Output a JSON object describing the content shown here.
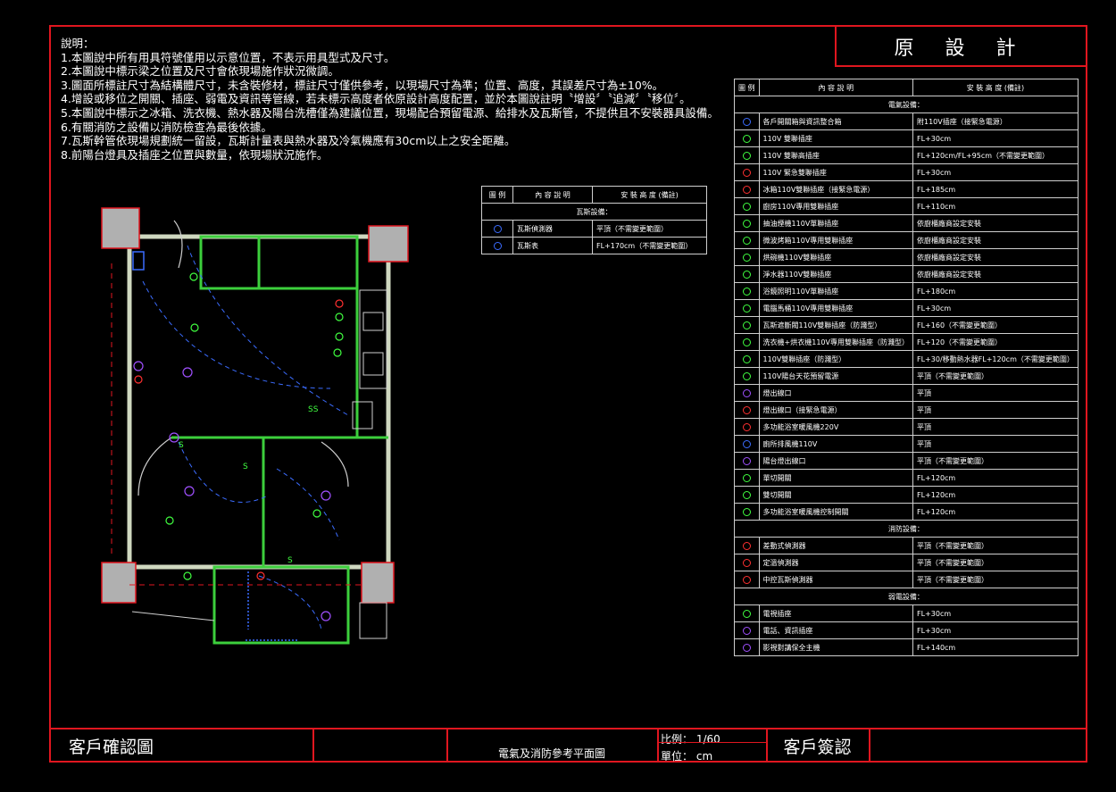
{
  "title": "原 設 計",
  "notes": [
    "說明：",
    "1.本圖說中所有用具符號僅用以示意位置，不表示用具型式及尺寸。",
    "2.本圖說中標示梁之位置及尺寸會依現場施作狀況微調。",
    "3.圖面所標註尺寸為結構體尺寸，未含裝修材，標註尺寸僅供參考，以現場尺寸為準；位置、高度，其誤差尺寸為±10%。",
    "4.增設或移位之開關、插座、弱電及資訊等管線，若未標示高度者依原設計高度配置，並於本圖說註明〝增設〞〝追減〞〝移位〞。",
    "5.本圖說中標示之冰箱、洗衣機、熱水器及陽台洗槽僅為建議位置，現場配合預留電源、給排水及瓦斯管，不提供且不安裝器具設備。",
    "6.有關消防之設備以消防檢查為最後依據。",
    "7.瓦斯幹管依現場規劃統一留設，瓦斯計量表與熱水器及冷氣機應有30cm以上之安全距離。",
    "8.前陽台燈具及插座之位置與數量，依現場狀況施作。"
  ],
  "legend_headers": {
    "symbol": "圖 例",
    "content": "內 容 說 明",
    "height": "安 裝 高 度 (備註)"
  },
  "main_legend": {
    "sections": [
      {
        "name": "電氣設備：",
        "rows": [
          {
            "icon": "panel-icon",
            "color": "#3b6cff",
            "content": "各戶開關箱與資訊整合箱",
            "height": "附110V插座（接緊急電源）"
          },
          {
            "icon": "outlet-icon",
            "color": "#40ff40",
            "content": "110V 雙聯插座",
            "height": "FL+30cm"
          },
          {
            "icon": "outlet-high-icon",
            "color": "#40ff40",
            "content": "110V 雙聯高插座",
            "height": "FL+120cm/FL+95cm（不需變更範圍）"
          },
          {
            "icon": "outlet-emergency-icon",
            "color": "#ff3030",
            "content": "110V 緊急雙聯插座",
            "height": "FL+30cm"
          },
          {
            "icon": "outlet-fridge-icon",
            "color": "#ff3030",
            "content": "冰箱110V雙聯插座（接緊急電源）",
            "height": "FL+185cm"
          },
          {
            "icon": "outlet-kitchen-icon",
            "color": "#40ff40",
            "content": "廚房110V專用雙聯插座",
            "height": "FL+110cm"
          },
          {
            "icon": "outlet-hood-icon",
            "color": "#40ff40",
            "content": "抽油煙機110V單聯插座",
            "height": "依廚櫃廠商設定安裝"
          },
          {
            "icon": "outlet-microwave-icon",
            "color": "#40ff40",
            "content": "微波烤箱110V專用雙聯插座",
            "height": "依廚櫃廠商設定安裝"
          },
          {
            "icon": "outlet-dryer-icon",
            "color": "#40ff40",
            "content": "烘碗機110V雙聯插座",
            "height": "依廚櫃廠商設定安裝"
          },
          {
            "icon": "outlet-purifier-icon",
            "color": "#40ff40",
            "content": "淨水器110V雙聯插座",
            "height": "依廚櫃廠商設定安裝"
          },
          {
            "icon": "outlet-mirror-icon",
            "color": "#40ff40",
            "content": "浴鏡照明110V單聯插座",
            "height": "FL+180cm"
          },
          {
            "icon": "outlet-toilet-icon",
            "color": "#40ff40",
            "content": "電腦馬桶110V專用雙聯插座",
            "height": "FL+30cm"
          },
          {
            "icon": "outlet-gas-icon",
            "color": "#40ff40",
            "content": "瓦斯遮斷閥110V雙聯插座（防濺型）",
            "height": "FL+160（不需變更範圍）"
          },
          {
            "icon": "outlet-washer-icon",
            "color": "#40ff40",
            "content": "洗衣機+烘衣機110V專用雙聯插座（防濺型）",
            "height": "FL+120（不需變更範圍）"
          },
          {
            "icon": "outlet-splash-icon",
            "color": "#40ff40",
            "content": "110V雙聯插座（防濺型）",
            "height": "FL+30/移動熱水器FL+120cm（不需變更範圍）"
          },
          {
            "icon": "balcony-power-icon",
            "color": "#40ff40",
            "content": "110V陽台天花預留電源",
            "height": "平頂（不需變更範圍）"
          },
          {
            "icon": "light-outlet-icon",
            "color": "#a050ff",
            "content": "燈出線口",
            "height": "平頂"
          },
          {
            "icon": "light-emergency-icon",
            "color": "#ff3030",
            "content": "燈出線口（接緊急電源）",
            "height": "平頂"
          },
          {
            "icon": "bath-heater-icon",
            "color": "#ff3030",
            "content": "多功能浴室暖風機220V",
            "height": "平頂"
          },
          {
            "icon": "exhaust-fan-icon",
            "color": "#3b6cff",
            "content": "廁所排風機110V",
            "height": "平頂"
          },
          {
            "icon": "balcony-light-icon",
            "color": "#a050ff",
            "content": "陽台燈出線口",
            "height": "平頂（不需變更範圍）"
          },
          {
            "icon": "single-switch-icon",
            "color": "#40ff40",
            "content": "單切開關",
            "height": "FL+120cm"
          },
          {
            "icon": "double-switch-icon",
            "color": "#40ff40",
            "content": "雙切開關",
            "height": "FL+120cm"
          },
          {
            "icon": "heater-switch-icon",
            "color": "#40ff40",
            "content": "多功能浴室暖風機控制開關",
            "height": "FL+120cm"
          }
        ]
      },
      {
        "name": "消防設備：",
        "rows": [
          {
            "icon": "smoke-detector-icon",
            "color": "#ff3030",
            "content": "差動式偵測器",
            "height": "平頂（不需變更範圍）"
          },
          {
            "icon": "heat-detector-icon",
            "color": "#ff3030",
            "content": "定溫偵測器",
            "height": "平頂（不需變更範圍）"
          },
          {
            "icon": "gas-detector-icon",
            "color": "#ff3030",
            "content": "中控瓦斯偵測器",
            "height": "平頂（不需變更範圍）"
          }
        ]
      },
      {
        "name": "弱電設備：",
        "rows": [
          {
            "icon": "tv-outlet-icon",
            "color": "#40ff40",
            "content": "電視插座",
            "height": "FL+30cm"
          },
          {
            "icon": "phone-outlet-icon",
            "color": "#a050ff",
            "content": "電話、資訊插座",
            "height": "FL+30cm"
          },
          {
            "icon": "intercom-icon",
            "color": "#a050ff",
            "content": "影視對講保全主機",
            "height": "FL+140cm"
          }
        ]
      }
    ]
  },
  "gas_legend": {
    "section": "瓦斯設備：",
    "rows": [
      {
        "icon": "gas-detector-round-icon",
        "color": "#3b6cff",
        "content": "瓦斯偵測器",
        "height": "平頂（不需變更範圍）"
      },
      {
        "icon": "gas-meter-icon",
        "color": "#3b6cff",
        "content": "瓦斯表",
        "height": "FL+170cm（不需變更範圍）"
      }
    ]
  },
  "footer": {
    "confirm": "客戶確認圖",
    "drawing_name": "電氣及消防參考平面圖",
    "scale_label": "比例：",
    "scale_value": "1/60",
    "unit_label": "單位：",
    "unit_value": "cm",
    "sign": "客戶簽認"
  },
  "plan_labels": {
    "single_switch": "S",
    "double_switch": "SS"
  }
}
